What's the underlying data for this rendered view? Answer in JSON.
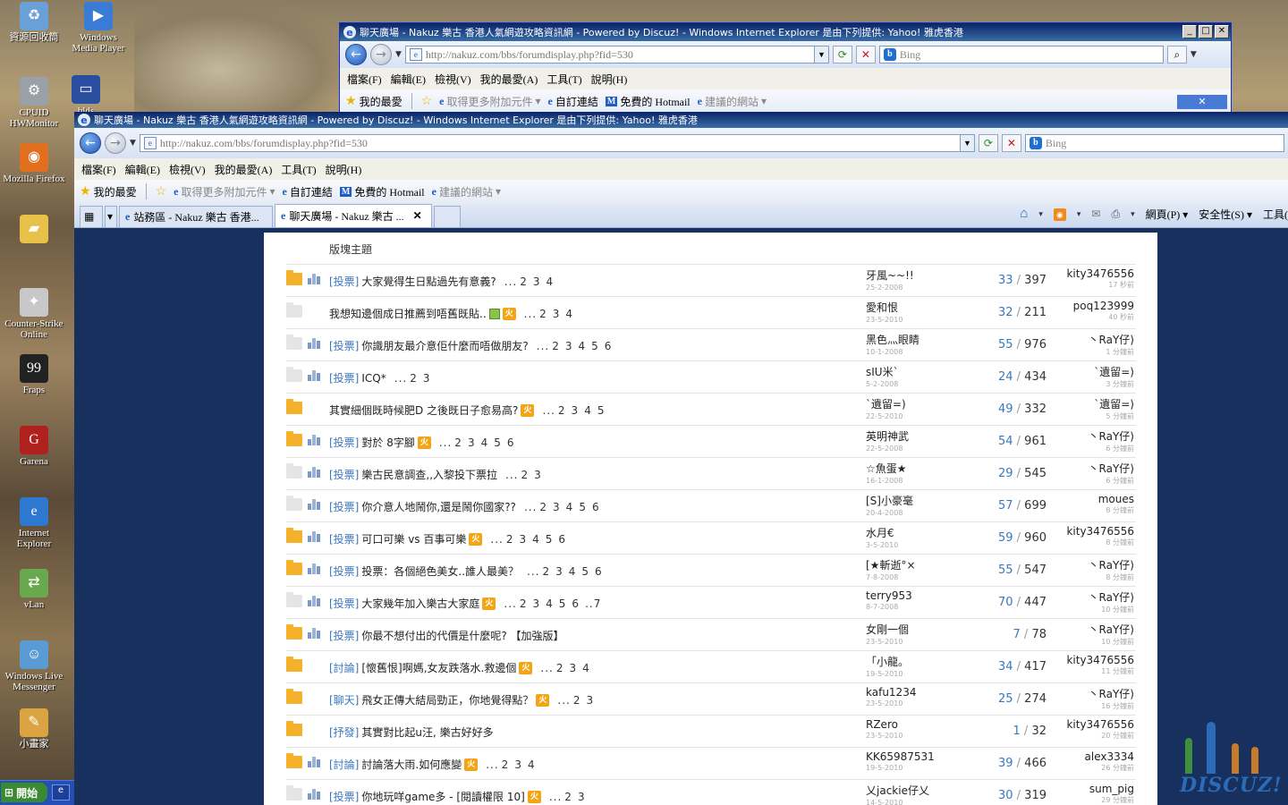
{
  "desktop_icons": [
    {
      "label": "資源回收筒",
      "icon": "recycle-bin-icon",
      "color": "#6aa0d8",
      "glyph": "♻"
    },
    {
      "label": "Windows Media Player",
      "icon": "media-player-icon",
      "color": "#3a7bd5",
      "glyph": "▶"
    },
    {
      "label": "CPUID HWMonitor",
      "icon": "hwmonitor-icon",
      "color": "#9aa0a8",
      "glyph": "⚙"
    },
    {
      "label": "hlds",
      "icon": "app-window-icon",
      "color": "#2a4fa0",
      "glyph": "▭"
    },
    {
      "label": "Mozilla Firefox",
      "icon": "firefox-icon",
      "color": "#e07020",
      "glyph": "◉"
    },
    {
      "label": "",
      "icon": "folder-icon",
      "color": "#e8c14a",
      "glyph": "▰"
    },
    {
      "label": "Counter-Strike Online",
      "icon": "counter-strike-icon",
      "color": "#c8c8c8",
      "glyph": "✦"
    },
    {
      "label": "Fraps",
      "icon": "fraps-icon",
      "color": "#222222",
      "glyph": "99"
    },
    {
      "label": "Garena",
      "icon": "garena-icon",
      "color": "#b0201c",
      "glyph": "G"
    },
    {
      "label": "Internet Explorer",
      "icon": "internet-explorer-icon",
      "color": "#2f78d0",
      "glyph": "e"
    },
    {
      "label": "vLan",
      "icon": "vlan-icon",
      "color": "#6aa84f",
      "glyph": "⇄"
    },
    {
      "label": "Windows Live Messenger",
      "icon": "messenger-icon",
      "color": "#5b9bd5",
      "glyph": "☺"
    },
    {
      "label": "小畫家",
      "icon": "paint-icon",
      "color": "#d9a441",
      "glyph": "✎"
    }
  ],
  "taskbar": {
    "start_label": "開始"
  },
  "back_window": {
    "title": "聊天廣場 - Nakuz 樂古 香港人氣網遊攻略資訊網 - Powered by Discuz! - Windows Internet Explorer 是由下列提供: Yahoo! 雅虎香港",
    "url": "http://nakuz.com/bbs/forumdisplay.php?fid=530",
    "search_placeholder": "Bing"
  },
  "menu": [
    "檔案(F)",
    "編輯(E)",
    "檢視(V)",
    "我的最愛(A)",
    "工具(T)",
    "說明(H)"
  ],
  "favorites_bar": {
    "favorites": "我的最愛",
    "get_addons": "取得更多附加元件",
    "custom_links": "自訂連結",
    "hotmail": "免費的 Hotmail",
    "suggested": "建議的網站"
  },
  "front_window": {
    "title": "聊天廣場 - Nakuz 樂古 香港人氣網遊攻略資訊網 - Powered by Discuz! - Windows Internet Explorer 是由下列提供: Yahoo! 雅虎香港",
    "url": "http://nakuz.com/bbs/forumdisplay.php?fid=530",
    "search_placeholder": "Bing"
  },
  "tabs": [
    {
      "label": "站務區 - Nakuz 樂古 香港...",
      "active": false
    },
    {
      "label": "聊天廣場 - Nakuz 樂古 ...",
      "active": true
    }
  ],
  "tab_tools": {
    "page": "網頁(P)",
    "safety": "安全性(S)",
    "tools": "工具("
  },
  "forum": {
    "board_topics": "版塊主題",
    "hot_label": "火",
    "threads": [
      {
        "folder": "orange",
        "poll": true,
        "type": "[投票]",
        "title": "大家覺得生日點過先有意義?",
        "hot": false,
        "img": false,
        "pages": [
          "2",
          "3",
          "4"
        ],
        "author": "牙風~~!!",
        "date": "25-2-2008",
        "replies": "33",
        "views": "397",
        "last_user": "kity3476556",
        "last_time": "17 秒前"
      },
      {
        "folder": "grey",
        "poll": false,
        "type": "",
        "title": "我想知邊個成日推薦到唔舊既貼..",
        "hot": true,
        "img": true,
        "pages": [
          "2",
          "3",
          "4"
        ],
        "author": "愛和恨",
        "date": "23-5-2010",
        "replies": "32",
        "views": "211",
        "last_user": "poq123999",
        "last_time": "40 秒前"
      },
      {
        "folder": "grey",
        "poll": true,
        "type": "[投票]",
        "title": "你識朋友最介意佢什麼而唔做朋友?",
        "hot": false,
        "img": false,
        "pages": [
          "2",
          "3",
          "4",
          "5",
          "6"
        ],
        "author": "黑色灬眼睛",
        "date": "10-1-2008",
        "replies": "55",
        "views": "976",
        "last_user": "丶RaY仔)",
        "last_time": "1 分鐘前"
      },
      {
        "folder": "grey",
        "poll": true,
        "type": "[投票]",
        "title": "ICQ*",
        "hot": false,
        "img": false,
        "pages": [
          "2",
          "3"
        ],
        "author": "sIU米`",
        "date": "5-2-2008",
        "replies": "24",
        "views": "434",
        "last_user": "`遺留=)",
        "last_time": "3 分鐘前"
      },
      {
        "folder": "orange",
        "poll": false,
        "type": "",
        "title": "其實細個既時候肥D 之後既日子愈易高?",
        "hot": true,
        "img": false,
        "pages": [
          "2",
          "3",
          "4",
          "5"
        ],
        "author": "`遺留=)",
        "date": "22-5-2010",
        "replies": "49",
        "views": "332",
        "last_user": "`遺留=)",
        "last_time": "5 分鐘前"
      },
      {
        "folder": "orange",
        "poll": true,
        "type": "[投票]",
        "title": "對於 8字腳",
        "hot": true,
        "img": false,
        "pages": [
          "2",
          "3",
          "4",
          "5",
          "6"
        ],
        "author": "英明神武",
        "date": "22-5-2008",
        "replies": "54",
        "views": "961",
        "last_user": "丶RaY仔)",
        "last_time": "6 分鐘前"
      },
      {
        "folder": "grey",
        "poll": true,
        "type": "[投票]",
        "title": "樂古民意調查,,入黎投下票拉",
        "hot": false,
        "img": false,
        "pages": [
          "2",
          "3"
        ],
        "author": "☆魚蛋★",
        "date": "16-1-2008",
        "replies": "29",
        "views": "545",
        "last_user": "丶RaY仔)",
        "last_time": "6 分鐘前"
      },
      {
        "folder": "grey",
        "poll": true,
        "type": "[投票]",
        "title": "你介意人地鬧你,還是鬧你國家??",
        "hot": false,
        "img": false,
        "pages": [
          "2",
          "3",
          "4",
          "5",
          "6"
        ],
        "author": "[S]小豪毫",
        "date": "20-4-2008",
        "replies": "57",
        "views": "699",
        "last_user": "moues",
        "last_time": "8 分鐘前"
      },
      {
        "folder": "orange",
        "poll": true,
        "type": "[投票]",
        "title": "可口可樂 vs 百事可樂",
        "hot": true,
        "img": false,
        "pages": [
          "2",
          "3",
          "4",
          "5",
          "6"
        ],
        "author": "水月€",
        "date": "3-5-2010",
        "replies": "59",
        "views": "960",
        "last_user": "kity3476556",
        "last_time": "8 分鐘前"
      },
      {
        "folder": "orange",
        "poll": true,
        "type": "[投票]",
        "title": "投票：各個絕色美女..誰人最美？",
        "hot": false,
        "img": false,
        "pages": [
          "2",
          "3",
          "4",
          "5",
          "6"
        ],
        "author": "[★斬逝°×",
        "date": "7-8-2008",
        "replies": "55",
        "views": "547",
        "last_user": "丶RaY仔)",
        "last_time": "8 分鐘前"
      },
      {
        "folder": "grey",
        "poll": true,
        "type": "[投票]",
        "title": "大家幾年加入樂古大家庭",
        "hot": true,
        "img": false,
        "pages": [
          "2",
          "3",
          "4",
          "5",
          "6",
          "..7"
        ],
        "author": "terry953",
        "date": "8-7-2008",
        "replies": "70",
        "views": "447",
        "last_user": "丶RaY仔)",
        "last_time": "10 分鐘前"
      },
      {
        "folder": "orange",
        "poll": true,
        "type": "[投票]",
        "title": "你最不想付出的代價是什麼呢? 【加強版】",
        "hot": false,
        "img": false,
        "pages": [],
        "author": "女剛一個",
        "date": "23-5-2010",
        "replies": "7",
        "views": "78",
        "last_user": "丶RaY仔)",
        "last_time": "10 分鐘前"
      },
      {
        "folder": "orange",
        "poll": false,
        "type": "[討論]",
        "title": "[懷舊恨]啊媽,女友跌落水.救邊個",
        "hot": true,
        "img": false,
        "pages": [
          "2",
          "3",
          "4"
        ],
        "author": "「小龍。",
        "date": "19-5-2010",
        "replies": "34",
        "views": "417",
        "last_user": "kity3476556",
        "last_time": "11 分鐘前"
      },
      {
        "folder": "orange",
        "poll": false,
        "type": "[聊天]",
        "title": "飛女正傳大結局勁正，你地覺得點？",
        "hot": true,
        "img": false,
        "pages": [
          "2",
          "3"
        ],
        "author": "kafu1234",
        "date": "23-5-2010",
        "replies": "25",
        "views": "274",
        "last_user": "丶RaY仔)",
        "last_time": "16 分鐘前"
      },
      {
        "folder": "orange",
        "poll": false,
        "type": "[抒發]",
        "title": "其實對比起u汪, 樂古好好多",
        "hot": false,
        "img": false,
        "pages": [],
        "author": "RZero",
        "date": "23-5-2010",
        "replies": "1",
        "views": "32",
        "last_user": "kity3476556",
        "last_time": "20 分鐘前"
      },
      {
        "folder": "orange",
        "poll": true,
        "type": "[討論]",
        "title": "討論落大雨.如何應變",
        "hot": true,
        "img": false,
        "pages": [
          "2",
          "3",
          "4"
        ],
        "author": "KK65987531",
        "date": "19-5-2010",
        "replies": "39",
        "views": "466",
        "last_user": "alex3334",
        "last_time": "26 分鐘前"
      },
      {
        "folder": "grey",
        "poll": true,
        "type": "[投票]",
        "title": "你地玩咩game多 - [閱讀權限 10]",
        "hot": true,
        "img": false,
        "pages": [
          "2",
          "3"
        ],
        "author": "乂jackie仔乂",
        "date": "14-5-2010",
        "replies": "30",
        "views": "319",
        "last_user": "sum_pig",
        "last_time": "29 分鐘前"
      }
    ]
  },
  "logo": {
    "text": "DISCUZ!"
  }
}
